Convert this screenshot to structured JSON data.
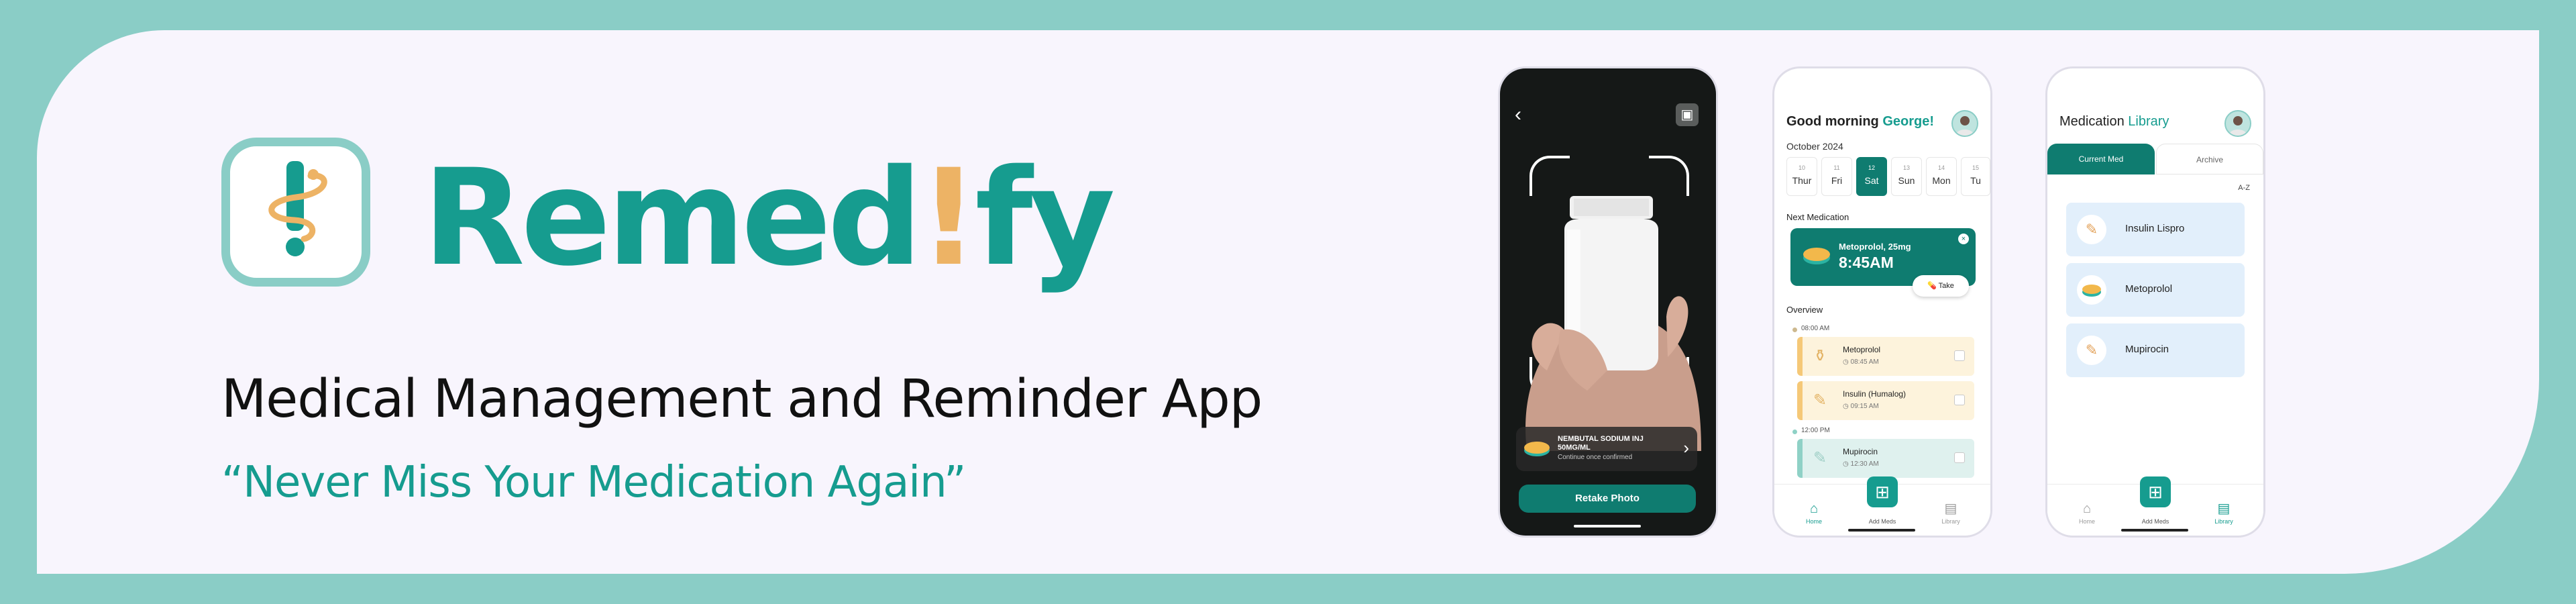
{
  "brand": {
    "name_part1": "Remed",
    "name_bang": "!",
    "name_part2": "fy",
    "subtitle": "Medical Management and Reminder App",
    "tagline": "“Never Miss Your Medication Again”",
    "logo_icon": "caduceus-exclamation-icon",
    "colors": {
      "teal": "#169c8f",
      "dark_teal": "#0f7c70",
      "gold": "#edb365",
      "background": "#8acdc6",
      "card": "#f8f5fd"
    }
  },
  "scan_screen": {
    "back_icon": "chevron-left-icon",
    "gallery_icon": "gallery-icon",
    "detected_name": "NEMBUTAL SODIUM INJ 50MG/ML",
    "detected_hint": "Continue once confirmed",
    "retake_label": "Retake Photo"
  },
  "home_screen": {
    "greeting": "Good morning ",
    "user_name": "George!",
    "month": "October 2024",
    "days": [
      {
        "num": "10",
        "name": "Thur",
        "selected": false
      },
      {
        "num": "11",
        "name": "Fri",
        "selected": false
      },
      {
        "num": "12",
        "name": "Sat",
        "selected": true
      },
      {
        "num": "13",
        "name": "Sun",
        "selected": false
      },
      {
        "num": "14",
        "name": "Mon",
        "selected": false
      },
      {
        "num": "15",
        "name": "Tu",
        "selected": false
      }
    ],
    "next_title": "Next Medication",
    "next_med": {
      "name": "Metoprolol, 25mg",
      "time": "8:45AM",
      "take_label": "Take"
    },
    "overview_title": "Overview",
    "timeline": [
      {
        "time": "08:00 AM"
      },
      {
        "time": "12:00 PM"
      }
    ],
    "entries": [
      {
        "name": "Metoprolol",
        "time": "08:45 AM"
      },
      {
        "name": "Insulin (Humalog)",
        "time": "09:15 AM"
      },
      {
        "name": "Mupirocin",
        "time": "12:30 AM"
      }
    ],
    "nav": {
      "home": "Home",
      "add": "Add Meds",
      "library": "Library"
    }
  },
  "library_screen": {
    "title_part1": "Medication ",
    "title_part2": "Library",
    "tab_current": "Current Med",
    "tab_archive": "Archive",
    "sort": "A-Z",
    "meds": [
      {
        "name": "Insulin Lispro",
        "icon": "syringe-icon"
      },
      {
        "name": "Metoprolol",
        "icon": "pill-icon"
      },
      {
        "name": "Mupirocin",
        "icon": "ointment-icon"
      }
    ],
    "nav": {
      "home": "Home",
      "add": "Add Meds",
      "library": "Library"
    }
  }
}
